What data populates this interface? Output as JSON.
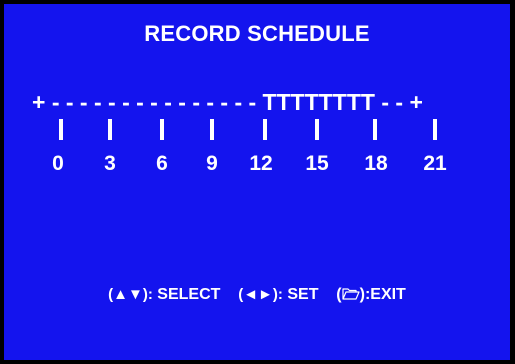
{
  "screen": {
    "title": "RECORD SCHEDULE",
    "background_color": "#1414ee",
    "text_color": "#ffffff"
  },
  "timeline": {
    "schedule_bar": "+---------------TTTTTTTT--+",
    "hours": [
      "0",
      "3",
      "6",
      "9",
      "12",
      "15",
      "18",
      "21"
    ]
  },
  "help": {
    "select_keys": "(▲▼):",
    "select_label": "SELECT",
    "set_keys": "(◄►):",
    "set_label": "SET",
    "exit_open": "(",
    "exit_icon": "folder-icon",
    "exit_close": "):EXIT"
  }
}
